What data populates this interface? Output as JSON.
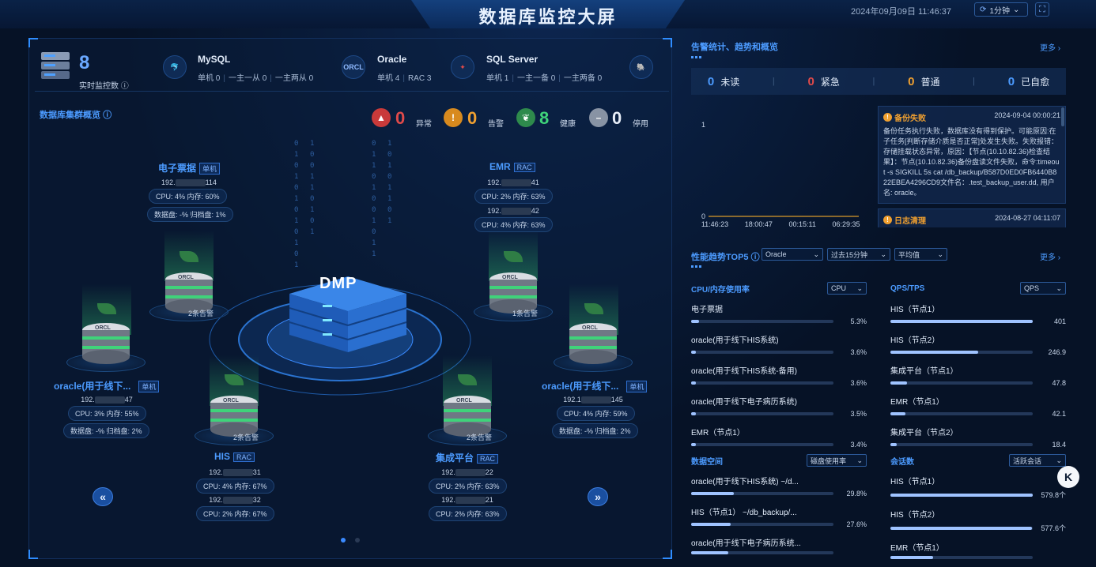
{
  "header": {
    "title": "数据库监控大屏",
    "datetime": "2024年09月09日 11:46:37",
    "refresh": "1分钟"
  },
  "summary": {
    "monitor_count": "8",
    "monitor_label": "实时监控数",
    "types": [
      {
        "name": "MySQL",
        "subs": [
          "单机 0",
          "一主一从 0",
          "一主两从 0"
        ]
      },
      {
        "name": "Oracle",
        "subs": [
          "单机 4",
          "RAC 3"
        ]
      },
      {
        "name": "SQL Server",
        "subs": [
          "单机 1",
          "一主一备 0",
          "一主两备 0"
        ]
      }
    ],
    "oracle_icon": "ORCL"
  },
  "cluster": {
    "title": "数据库集群概览",
    "status": [
      {
        "num": "0",
        "label": "异常",
        "color": "#e04a4a"
      },
      {
        "num": "0",
        "label": "告警",
        "color": "#f0a030"
      },
      {
        "num": "8",
        "label": "健康",
        "color": "#3fd37a"
      },
      {
        "num": "0",
        "label": "停用",
        "color": "#e8eef8"
      }
    ],
    "center_label": "DMP",
    "nodes": {
      "n1": {
        "name": "电子票据",
        "tag": "单机",
        "ips": [
          "192.",
          "114"
        ],
        "pills": [
          "CPU: 4% 内存: 60%",
          "数据盘: -% 归档盘: 1%"
        ],
        "alarm": "2条告警"
      },
      "n2": {
        "name": "EMR",
        "tag": "RAC",
        "ips": [
          "192.",
          "41"
        ],
        "ips2": [
          "192.",
          "42"
        ],
        "pills": [
          "CPU: 2% 内存: 63%",
          "CPU: 4% 内存: 63%"
        ],
        "alarm": "1条告警"
      },
      "n3": {
        "name": "oracle(用于线下...",
        "tag": "单机",
        "ips": [
          "192.",
          "47"
        ],
        "pills": [
          "CPU: 3% 内存: 55%",
          "数据盘: -% 归档盘: 2%"
        ]
      },
      "n4": {
        "name": "oracle(用于线下...",
        "tag": "单机",
        "ips": [
          "192.1",
          "145"
        ],
        "pills": [
          "CPU: 4% 内存: 59%",
          "数据盘: -% 归档盘: 2%"
        ]
      },
      "n5": {
        "name": "HIS",
        "tag": "RAC",
        "ips": [
          "192.",
          "31"
        ],
        "ips2": [
          "192.",
          "32"
        ],
        "pills": [
          "CPU: 4% 内存: 67%",
          "CPU: 2% 内存: 67%"
        ],
        "alarm": "2条告警"
      },
      "n6": {
        "name": "集成平台",
        "tag": "RAC",
        "ips": [
          "192.",
          "22"
        ],
        "ips2": [
          "192.",
          "21"
        ],
        "pills": [
          "CPU: 2% 内存: 63%",
          "CPU: 2% 内存: 63%"
        ],
        "alarm": "2条告警"
      }
    },
    "db_label": "ORCL"
  },
  "alerts": {
    "title": "告警统计、趋势和概览",
    "more": "更多",
    "counts": [
      {
        "num": "0",
        "label": "未读",
        "color": "#4c9bff"
      },
      {
        "num": "0",
        "label": "紧急",
        "color": "#e04a4a"
      },
      {
        "num": "0",
        "label": "普通",
        "color": "#f0a030"
      },
      {
        "num": "0",
        "label": "已自愈",
        "color": "#4c9bff"
      }
    ],
    "chart_data": {
      "type": "line",
      "x": [
        "11:46:23",
        "18:00:47",
        "00:15:11",
        "06:29:35"
      ],
      "y_ticks": [
        "0",
        "1"
      ],
      "ylim": [
        0,
        1
      ],
      "series": [
        {
          "values": [
            0,
            0,
            0,
            0
          ]
        }
      ]
    },
    "items": [
      {
        "title": "备份失败",
        "time": "2024-09-04 00:00:21",
        "body": "备份任务执行失败，数据库没有得到保护。可能原因:在子任务[判断存储介质是否正常]处发生失败。失败报错：存储挂载状态异常，原因：【节点(10.10.82.36)检查结果】：节点(10.10.82.36)备份盘读文件失败，命令:timeout -s SIGKILL 5s cat /db_backup/B587D0ED0FB6440B822EBEA4296CD9文件名：.test_backup_user.dd, 用户名: oracle。"
      },
      {
        "title": "日志清理",
        "time": "2024-08-27 04:11:07"
      }
    ]
  },
  "perf": {
    "title": "性能趋势TOP5",
    "more": "更多",
    "selects": [
      "Oracle",
      "过去15分钟",
      "平均值"
    ],
    "cpu": {
      "title": "CPU/内存使用率",
      "select": "CPU",
      "rows": [
        {
          "name": "电子票据",
          "value": "5.3%",
          "pct": 5.3
        },
        {
          "name": "oracle(用于线下HIS系统)",
          "value": "3.6%",
          "pct": 3.6
        },
        {
          "name": "oracle(用于线下HIS系统-备用)",
          "value": "3.6%",
          "pct": 3.6
        },
        {
          "name": "oracle(用于线下电子病历系统)",
          "value": "3.5%",
          "pct": 3.5
        },
        {
          "name": "EMR（节点1）",
          "value": "3.4%",
          "pct": 3.4
        }
      ]
    },
    "qps": {
      "title": "QPS/TPS",
      "select": "QPS",
      "rows": [
        {
          "name": "HIS（节点1）",
          "value": "401",
          "pct": 100
        },
        {
          "name": "HIS（节点2）",
          "value": "246.9",
          "pct": 61.6
        },
        {
          "name": "集成平台（节点1）",
          "value": "47.8",
          "pct": 11.9
        },
        {
          "name": "EMR（节点1）",
          "value": "42.1",
          "pct": 10.5
        },
        {
          "name": "集成平台（节点2）",
          "value": "18.4",
          "pct": 4.6
        }
      ]
    },
    "space": {
      "title": "数据空间",
      "select": "磁盘使用率",
      "rows": [
        {
          "name": "oracle(用于线下HIS系统) ~/d...",
          "value": "29.8%",
          "pct": 29.8
        },
        {
          "name": "HIS（节点1） ~/db_backup/...",
          "value": "27.6%",
          "pct": 27.6
        },
        {
          "name": "oracle(用于线下电子病历系统...",
          "value": "",
          "pct": 26
        }
      ]
    },
    "sessions": {
      "title": "会话数",
      "select": "活跃会话",
      "rows": [
        {
          "name": "HIS（节点1）",
          "value": "579.8个",
          "pct": 100
        },
        {
          "name": "HIS（节点2）",
          "value": "577.6个",
          "pct": 99.6
        },
        {
          "name": "EMR（节点1）",
          "value": "",
          "pct": 30
        }
      ]
    }
  },
  "fab": "K"
}
